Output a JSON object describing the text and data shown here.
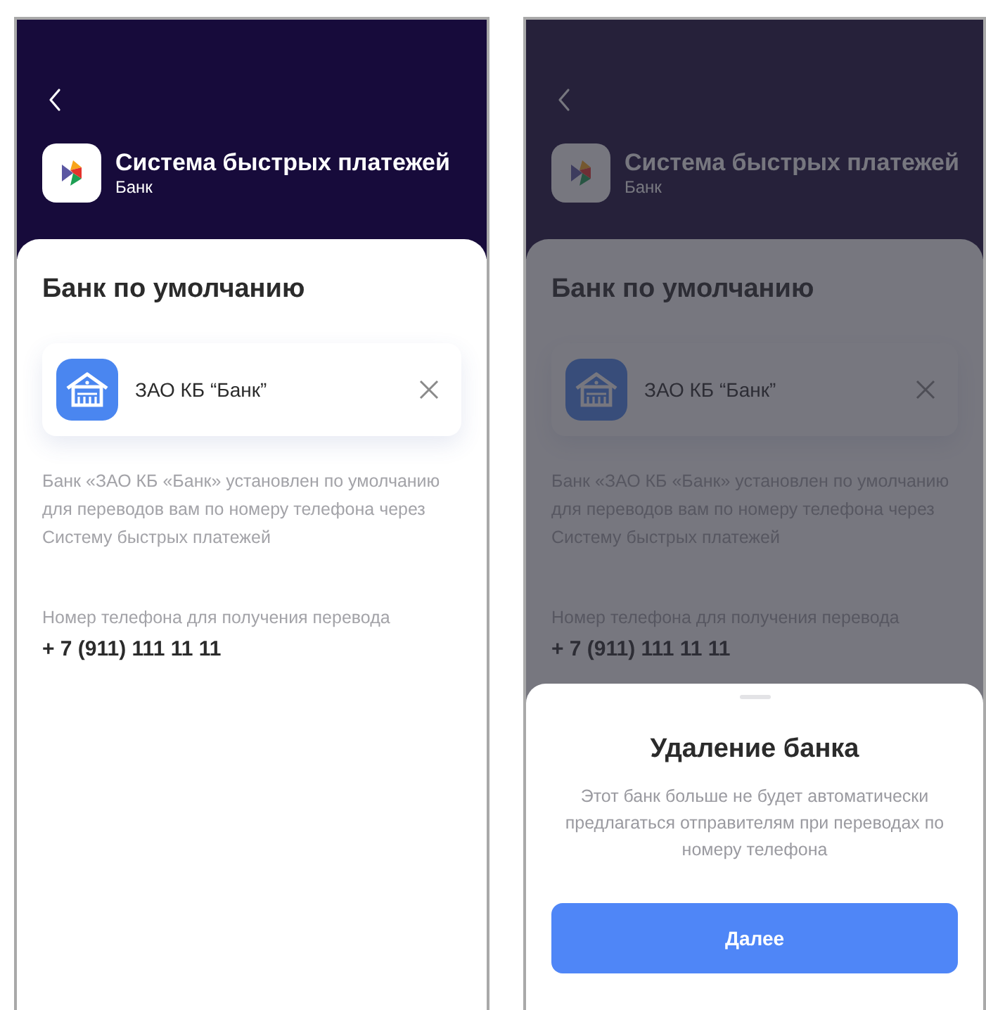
{
  "screens": [
    {
      "header": {
        "title": "Система быстрых платежей",
        "subtitle": "Банк"
      },
      "section_title": "Банк по умолчанию",
      "bank": {
        "name": "ЗАО КБ “Банк”"
      },
      "description": "Банк «ЗАО КБ «Банк» установлен по умолчанию для переводов вам по номеру телефона через Систему быстрых платежей",
      "phone_label": "Номер телефона для получения перевода",
      "phone_number": "+ 7 (911) 111 11 11",
      "dimmed": false
    },
    {
      "header": {
        "title": "Система быстрых платежей",
        "subtitle": "Банк"
      },
      "section_title": "Банк по умолчанию",
      "bank": {
        "name": "ЗАО КБ “Банк”"
      },
      "description": "Банк «ЗАО КБ «Банк» установлен по умолчанию для переводов вам по номеру телефона через Систему быстрых платежей",
      "phone_label": "Номер телефона для получения перевода",
      "phone_number": "+ 7 (911) 111 11 11",
      "dimmed": true,
      "dialog": {
        "title": "Удаление банка",
        "text": "Этот банк больше не будет автоматически предлагаться отправителям при переводах по номеру телефона",
        "button": "Далее"
      }
    }
  ]
}
